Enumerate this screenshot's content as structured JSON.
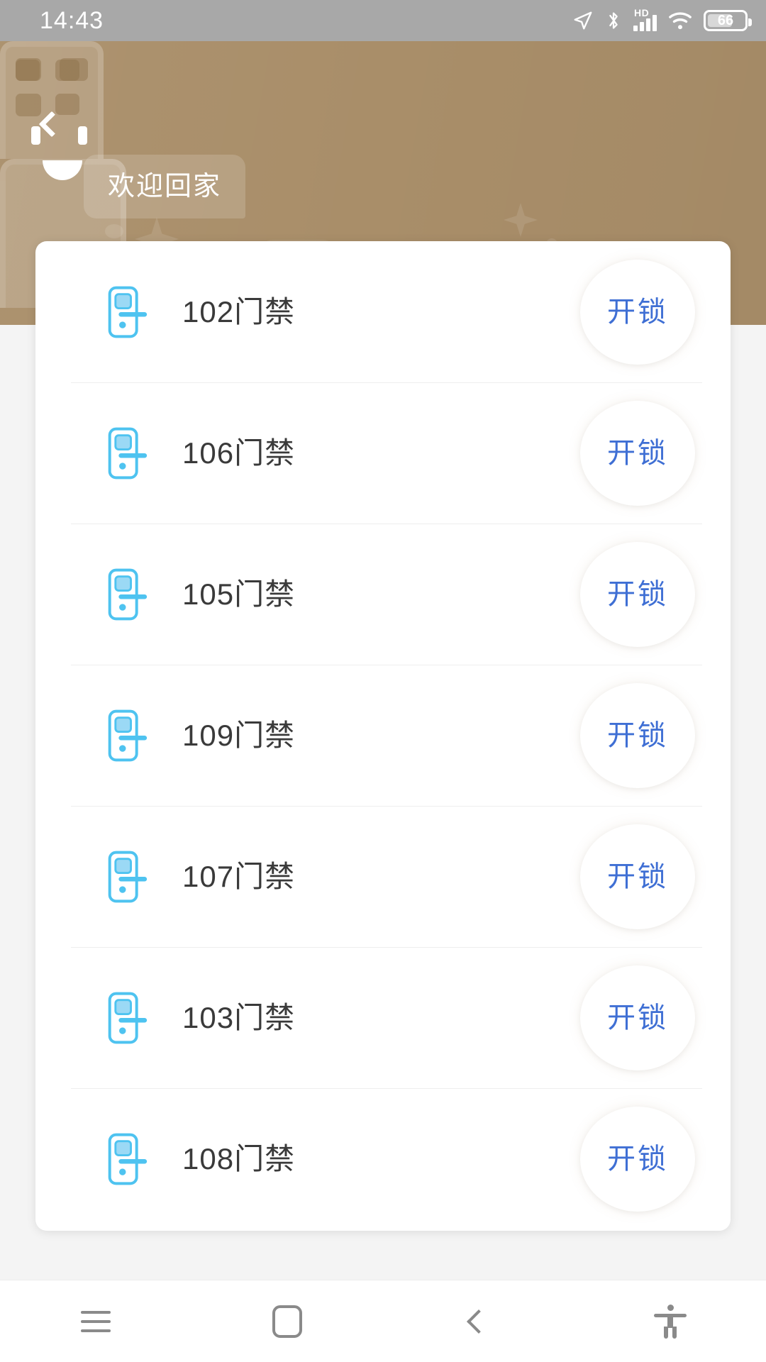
{
  "status_bar": {
    "time": "14:43",
    "battery_percent": "66",
    "icons": [
      "location-arrow-icon",
      "bluetooth-icon",
      "hd-signal-icon",
      "wifi-icon",
      "battery-icon"
    ]
  },
  "header": {
    "back_label": "‹",
    "greeting": "欢迎回家",
    "background_color": "#a98e69"
  },
  "access_list": {
    "items": [
      {
        "name": "102门禁",
        "action_label": "开锁"
      },
      {
        "name": "106门禁",
        "action_label": "开锁"
      },
      {
        "name": "105门禁",
        "action_label": "开锁"
      },
      {
        "name": "109门禁",
        "action_label": "开锁"
      },
      {
        "name": "107门禁",
        "action_label": "开锁"
      },
      {
        "name": "103门禁",
        "action_label": "开锁"
      },
      {
        "name": "108门禁",
        "action_label": "开锁"
      }
    ],
    "icon_name": "door-access-device-icon",
    "icon_color": "#4ec3f0",
    "action_color": "#3f6fd4"
  },
  "nav_bar": {
    "buttons": [
      {
        "name": "menu-button",
        "icon": "hamburger-icon"
      },
      {
        "name": "home-button",
        "icon": "square-icon"
      },
      {
        "name": "back-button",
        "icon": "chevron-left-icon"
      },
      {
        "name": "accessibility-button",
        "icon": "accessibility-icon"
      }
    ]
  }
}
